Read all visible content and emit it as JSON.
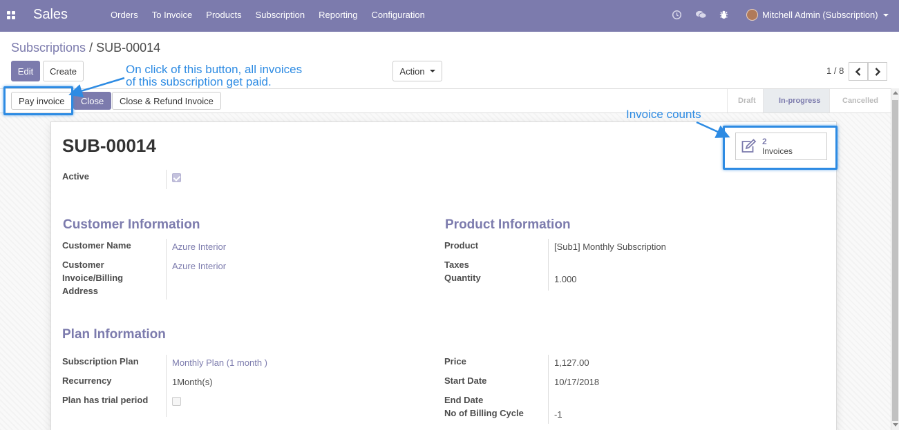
{
  "navbar": {
    "app_name": "Sales",
    "menu": [
      "Orders",
      "To Invoice",
      "Products",
      "Subscription",
      "Reporting",
      "Configuration"
    ],
    "user_name": "Mitchell Admin (Subscription)"
  },
  "breadcrumb": {
    "parent": "Subscriptions",
    "separator": "/",
    "current": "SUB-00014"
  },
  "toolbar": {
    "edit": "Edit",
    "create": "Create",
    "action": "Action"
  },
  "pager": {
    "value": "1 / 8"
  },
  "statusbar": {
    "buttons": {
      "pay_invoice": "Pay invoice",
      "close": "Close",
      "close_refund": "Close & Refund Invoice"
    },
    "stages": [
      "Draft",
      "In-progress",
      "Cancelled"
    ],
    "current_stage": "In-progress"
  },
  "record": {
    "title": "SUB-00014",
    "active_label": "Active",
    "active": true,
    "invoices_count": "2",
    "invoices_label": "Invoices"
  },
  "customer": {
    "heading": "Customer Information",
    "name_label": "Customer Name",
    "name_value": "Azure Interior",
    "address_label_1": "Customer",
    "address_label_2": "Invoice/Billing",
    "address_label_3": "Address",
    "address_value": "Azure Interior"
  },
  "product": {
    "heading": "Product Information",
    "product_label": "Product",
    "product_value": "[Sub1] Monthly Subscription",
    "taxes_label": "Taxes",
    "quantity_label": "Quantity",
    "quantity_value": "1.000"
  },
  "plan": {
    "heading": "Plan Information",
    "plan_label": "Subscription Plan",
    "plan_value": "Monthly Plan (1 month )",
    "recurrency_label": "Recurrency",
    "recurrency_value": "1Month(s)",
    "trial_label": "Plan has trial period",
    "trial": false,
    "price_label": "Price",
    "price_value": "1,127.00",
    "start_label": "Start Date",
    "start_value": "10/17/2018",
    "end_label": "End Date",
    "end_value": "",
    "cycle_label": "No of Billing Cycle",
    "cycle_value": "-1"
  },
  "annotations": {
    "pay_note_line1": "On click of this button, all invoices",
    "pay_note_line2": "of this subscription get paid.",
    "invoice_note": "Invoice counts"
  },
  "colors": {
    "brand": "#7c7bad",
    "annotation": "#2d8be3"
  }
}
